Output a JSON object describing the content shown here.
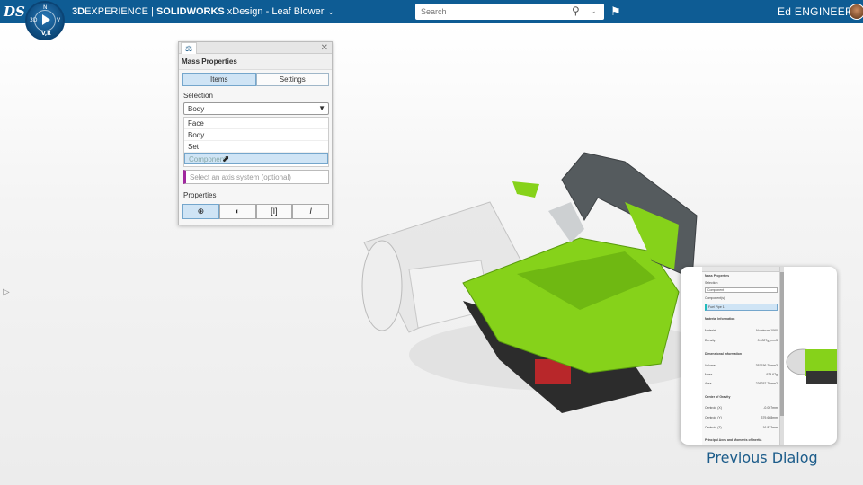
{
  "topbar": {
    "logo": "DS",
    "compass": {
      "top": "N",
      "left": "3D",
      "right": "V",
      "bottom": "V,R"
    },
    "app_brand_bold": "3D",
    "app_brand_rest": "EXPERIENCE",
    "separator": " | ",
    "app_solidworks": "SOLIDWORKS",
    "app_context": " xDesign - Leaf Blower",
    "search_placeholder": "Search",
    "user_name": "Ed ENGINEER",
    "bar_color": "#0e5c94"
  },
  "panel": {
    "title": "Mass Properties",
    "tabs": [
      {
        "label": "Items",
        "active": true
      },
      {
        "label": "Settings",
        "active": false
      }
    ],
    "selection_label": "Selection",
    "selection_value": "Body",
    "dropdown_options": [
      "Face",
      "Body",
      "Set",
      "Component"
    ],
    "axis_placeholder": "Select an axis system (optional)",
    "properties_label": "Properties",
    "property_buttons": [
      {
        "label": "⊕",
        "name": "mass-properties-icon",
        "active": true
      },
      {
        "label": "◐",
        "name": "center-of-mass-icon",
        "active": false
      },
      {
        "label": "[I]",
        "name": "inertia-tensor-icon",
        "active": false
      },
      {
        "label": "I",
        "name": "moment-of-inertia-icon",
        "active": false
      }
    ]
  },
  "previous_dialog": {
    "caption": "Previous Dialog",
    "mini": {
      "title": "Mass Properties",
      "selection_label": "Selection",
      "selection_value": "Component",
      "components_label": "Component(s)",
      "component_value": "Fuel Pipe 1",
      "material_section": "Material Information",
      "material_label": "Material",
      "material_value": "Aluminum 1060",
      "density_label": "Density",
      "density_value": "0.0027g_mm3",
      "dimensional_section": "Dimensional Information",
      "volume_label": "Volume",
      "volume_value": "357156.29mm3",
      "mass_label": "Mass",
      "mass_value": "979.67g",
      "area_label": "Area",
      "area_value": "236257.76mm2",
      "cog_section": "Center of Gravity",
      "cx_label": "Centroid (X)",
      "cx_value": "-0.007mm",
      "cy_label": "Centroid (Y)",
      "cy_value": "379.668mm",
      "cz_label": "Centroid (Z)",
      "cz_value": "-16.872mm",
      "axes_section": "Principal Axes and Moments of Inertia"
    }
  },
  "colors": {
    "accent": "#0e5c94",
    "green": "#86d21a",
    "selection_blue": "#cfe4f5",
    "axis_marker": "#a0289e"
  }
}
